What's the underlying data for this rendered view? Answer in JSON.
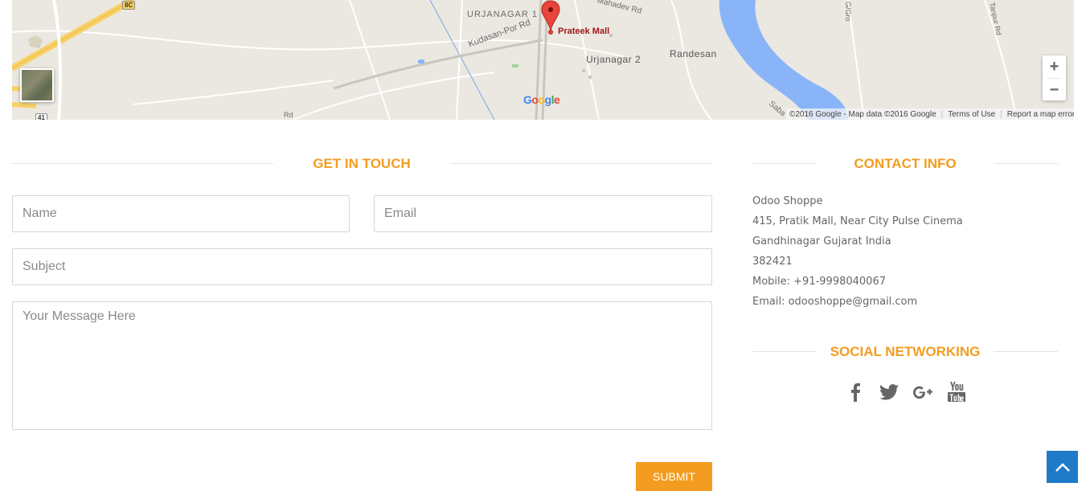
{
  "map": {
    "place_labels": {
      "urjanagar_1": "URJANAGAR 1",
      "mahadev_rd": "Mahadev Rd",
      "kudasan_por_rd": "Kudasan-Por Rd",
      "urjanagar_2": "Urjanagar 2",
      "randesan": "Randesan",
      "prateek_mall": "Prateek Mall",
      "sabarmati": "Saba",
      "gro": "G/Gro",
      "tanpur_rd": "Tanpur Rd",
      "rd": "Rd"
    },
    "route_shields": {
      "top": "8C",
      "bottom": "41"
    },
    "google_logo": [
      "G",
      "o",
      "o",
      "g",
      "l",
      "e"
    ],
    "zoom_in": "+",
    "zoom_out": "−",
    "attribution": "©2016 Google - Map data ©2016 Google",
    "terms_of_use": "Terms of Use",
    "report_error": "Report a map error",
    "colors": {
      "land": "#ebe8e1",
      "water": "#8ab4f8",
      "highway": "#f8d168",
      "marker": "#e8453c"
    }
  },
  "form": {
    "heading": "GET IN TOUCH",
    "name_placeholder": "Name",
    "email_placeholder": "Email",
    "subject_placeholder": "Subject",
    "message_placeholder": "Your Message Here",
    "submit_label": "SUBMIT"
  },
  "contact": {
    "heading": "CONTACT INFO",
    "company": "Odoo Shoppe",
    "address_line1": "415, Pratik Mall, Near City Pulse Cinema",
    "address_line2": "Gandhinagar Gujarat India",
    "postcode": "382421",
    "mobile": "Mobile: +91-9998040067",
    "email": "Email: odooshoppe@gmail.com"
  },
  "social": {
    "heading": "SOCIAL NETWORKING",
    "icons": [
      "facebook-icon",
      "twitter-icon",
      "google-plus-icon",
      "youtube-icon"
    ]
  },
  "theme": {
    "accent": "#f39c1f",
    "back_to_top": "#1f7ac7",
    "text": "#666666"
  }
}
